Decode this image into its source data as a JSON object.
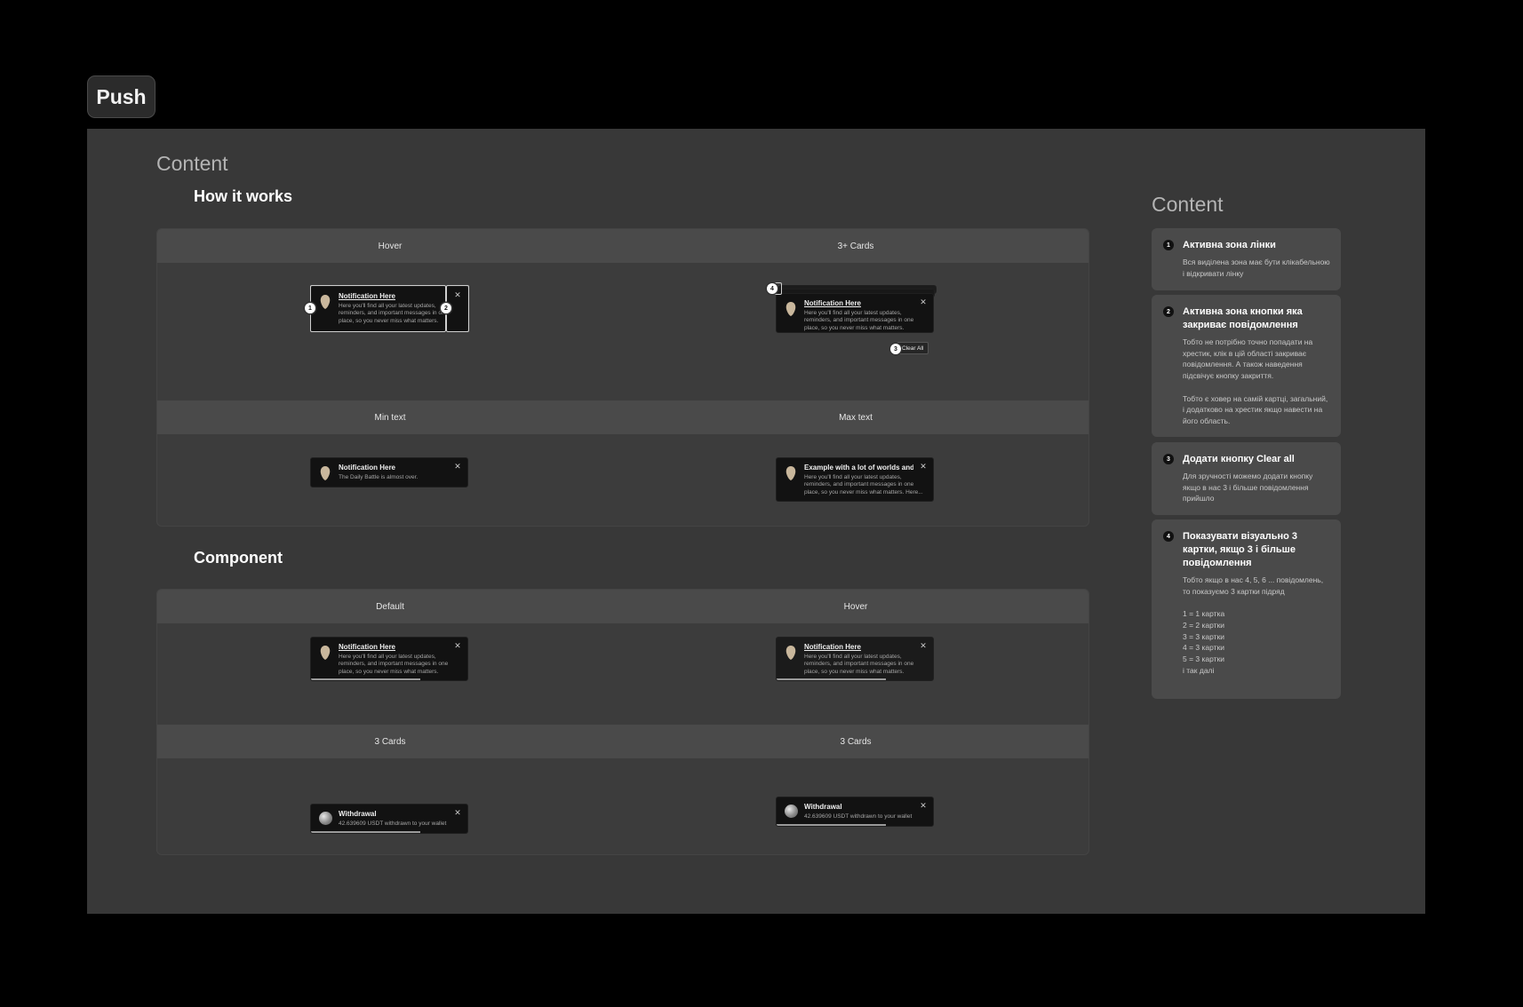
{
  "page_tag": "Push",
  "main": {
    "content_title": "Content",
    "how_it_works": {
      "title": "How it works",
      "row1": {
        "left_label": "Hover",
        "right_label": "3+ Cards"
      },
      "row2": {
        "left_label": "Min text",
        "right_label": "Max text"
      }
    },
    "component": {
      "title": "Component",
      "row1": {
        "left_label": "Default",
        "right_label": "Hover"
      },
      "row2": {
        "left_label": "3 Cards",
        "right_label": "3 Cards"
      }
    }
  },
  "cards": {
    "standard": {
      "title": "Notification Here",
      "body": "Here you'll find all your latest updates, reminders, and important messages in one place, so you never miss what matters."
    },
    "min": {
      "title": "Notification Here",
      "body": "The Daily Battle is almost over."
    },
    "max": {
      "title": "Example with a lot of worlds and...",
      "body": "Here you'll find all your latest updates, reminders, and important messages in one place, so you never miss what matters. Here..."
    },
    "withdrawal": {
      "title": "Withdrawal",
      "body": "42.639609 USDT withdrawn to your wallet"
    },
    "clear_all": "Clear All",
    "close_glyph": "✕",
    "progress_fraction": 0.7
  },
  "markers": [
    "1",
    "2",
    "3",
    "4"
  ],
  "sidebar": {
    "title": "Content",
    "notes": [
      {
        "num": "1",
        "title": "Активна зона лінки",
        "body": "Вся виділена зона має бути клікабельною і відкривати лінку"
      },
      {
        "num": "2",
        "title": "Активна зона кнопки яка закриває повідомлення",
        "body": "Тобто не потрібно точно попадати на хрестик, клік в цій області закриває повідомлення. А також наведення підсвічує кнопку закриття.\n\nТобто є ховер на самій картці, загальний, і додатково на хрестик якщо навести на його область."
      },
      {
        "num": "3",
        "title": "Додати кнопку Clear all",
        "body": "Для зручності можемо додати кнопку якщо в нас 3 і більше повідомлення прийшло"
      },
      {
        "num": "4",
        "title": "Показувати візуально 3 картки, якщо 3 і більше повідомлення",
        "body": "Тобто якщо в нас 4, 5, 6 ... повідомлень, то показуємо 3 картки підряд\n\n1 = 1 картка\n2 = 2 картки\n3 = 3 картки\n4 = 3 картки\n5 = 3 картки\nі так далі"
      }
    ]
  },
  "colors": {
    "frame_bg": "#383838",
    "card_bg": "#121212",
    "note_bg": "#4a4a4a"
  }
}
